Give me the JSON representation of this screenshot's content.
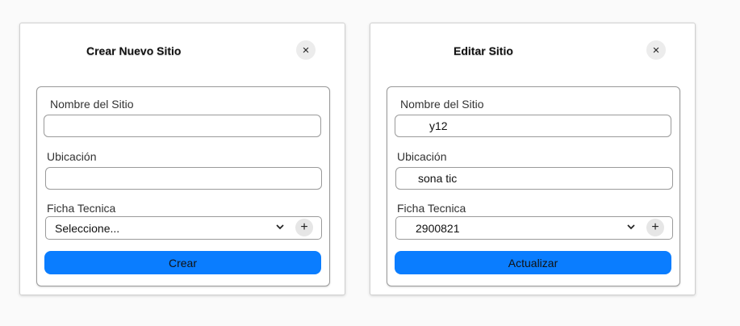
{
  "create_card": {
    "title": "Crear Nuevo Sitio",
    "close_icon": "×",
    "nombre_label": "Nombre del Sitio",
    "nombre_value": "",
    "ubicacion_label": "Ubicación",
    "ubicacion_value": "",
    "ficha_label": "Ficha Tecnica",
    "ficha_value": "Seleccione...",
    "add_icon": "+",
    "submit_label": "Crear"
  },
  "edit_card": {
    "title": "Editar Sitio",
    "close_icon": "×",
    "nombre_label": "Nombre del Sitio",
    "nombre_value": "y12",
    "ubicacion_label": "Ubicación",
    "ubicacion_value": "sona tic",
    "ficha_label": "Ficha Tecnica",
    "ficha_value": "2900821",
    "add_icon": "+",
    "submit_label": "Actualizar"
  },
  "colors": {
    "primary_button": "#0a7dff"
  }
}
